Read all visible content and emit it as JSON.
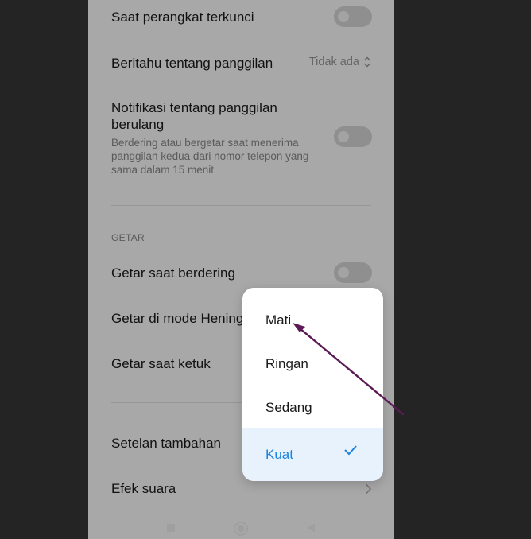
{
  "settings": {
    "locked": {
      "title": "Saat perangkat terkunci"
    },
    "notify_calls": {
      "title": "Beritahu tentang panggilan",
      "value": "Tidak ada"
    },
    "repeat_calls": {
      "title": "Notifikasi tentang panggilan berulang",
      "description": "Berdering atau bergetar saat menerima panggilan kedua dari nomor telepon yang sama dalam 15 menit"
    },
    "vibrate_section": "GETAR",
    "vibrate_ringing": {
      "title": "Getar saat berdering"
    },
    "vibrate_silent": {
      "title": "Getar di mode Hening"
    },
    "vibrate_tap": {
      "title": "Getar saat ketuk"
    },
    "additional": {
      "title": "Setelan tambahan"
    },
    "sound_effects": {
      "title": "Efek suara"
    }
  },
  "popup": {
    "options": [
      {
        "label": "Mati",
        "selected": false
      },
      {
        "label": "Ringan",
        "selected": false
      },
      {
        "label": "Sedang",
        "selected": false
      },
      {
        "label": "Kuat",
        "selected": true
      }
    ]
  },
  "colors": {
    "accent": "#1e84df",
    "selected_bg": "#e7f2fd",
    "annotation_arrow": "#5b1a55"
  }
}
